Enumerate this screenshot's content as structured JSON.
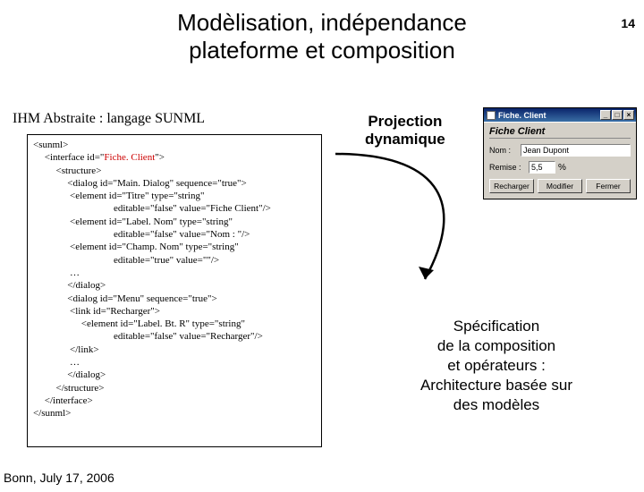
{
  "page_number": "14",
  "title_line1": "Modèlisation, indépendance",
  "title_line2": "plateforme et composition",
  "subtitle": "IHM Abstraite : langage SUNML",
  "code": {
    "l01": "<sunml>",
    "l02": " <interface id=\"",
    "l02b": "Fiche. Client",
    "l02c": "\">",
    "l03": "  <structure>",
    "l04": "   <dialog id=\"Main. Dialog\" sequence=\"true\">",
    "l05": "    <element id=\"Titre\" type=\"string\"",
    "l06": "editable=\"false\" value=\"Fiche Client\"/>",
    "l07": "    <element id=\"Label. Nom\" type=\"string\"",
    "l08": "editable=\"false\" value=\"Nom : \"/>",
    "l09": "    <element id=\"Champ. Nom\" type=\"string\"",
    "l10": "editable=\"true\" value=\"\"/>",
    "l11": "    …",
    "l12": "   </dialog>",
    "l13": "   <dialog id=\"Menu\" sequence=\"true\">",
    "l14": "    <link id=\"Recharger\">",
    "l15": "     <element id=\"Label. Bt. R\" type=\"string\"",
    "l16": "editable=\"false\" value=\"Recharger\"/>",
    "l17": "    </link>",
    "l18": "    …",
    "l19": "   </dialog>",
    "l20": "  </structure>",
    "l21": " </interface>",
    "l22": "</sunml>"
  },
  "projection_l1": "Projection",
  "projection_l2": "dynamique",
  "spec_l1": "Spécification",
  "spec_l2": "de la composition",
  "spec_l3": "et opérateurs :",
  "spec_l4": "Architecture basée sur",
  "spec_l5": "des modèles",
  "footer": "Bonn, July 17, 2006",
  "mock": {
    "title": "Fiche. Client",
    "heading": "Fiche Client",
    "label_nom": "Nom :",
    "value_nom": "Jean Dupont",
    "label_remise": "Remise :",
    "value_remise": "5,5",
    "pct": "%",
    "btn1": "Recharger",
    "btn2": "Modifier",
    "btn3": "Fermer",
    "min": "_",
    "max": "□",
    "close": "×"
  }
}
